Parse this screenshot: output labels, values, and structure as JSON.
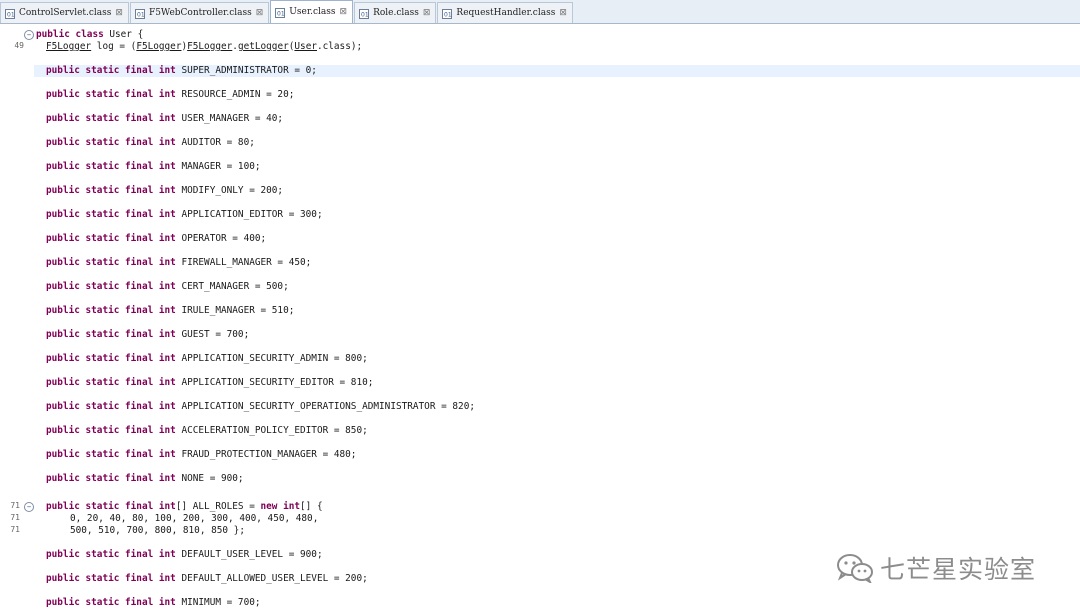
{
  "tabs": [
    {
      "label": "ControlServlet.class",
      "active": false
    },
    {
      "label": "F5WebController.class",
      "active": false
    },
    {
      "label": "User.class",
      "active": true
    },
    {
      "label": "Role.class",
      "active": false
    },
    {
      "label": "RequestHandler.class",
      "active": false
    }
  ],
  "gutter": {
    "line_49": "49",
    "line_71a": "71",
    "line_71b": "71",
    "line_71c": "71"
  },
  "code": {
    "class_decl_kw": "public class",
    "class_decl_rest": " User {",
    "log_type": "F5Logger",
    "log_mid": " log = (",
    "log_cast": "F5Logger",
    "log_close": ")",
    "log_call_type": "F5Logger",
    "log_dot": ".",
    "log_method": "getLogger",
    "log_open": "(",
    "log_arg": "User",
    "log_end": ".class);",
    "field_kw": "public static final int",
    "fields": [
      "SUPER_ADMINISTRATOR = 0;",
      "RESOURCE_ADMIN = 20;",
      "USER_MANAGER = 40;",
      "AUDITOR = 80;",
      "MANAGER = 100;",
      "MODIFY_ONLY = 200;",
      "APPLICATION_EDITOR = 300;",
      "OPERATOR = 400;",
      "FIREWALL_MANAGER = 450;",
      "CERT_MANAGER = 500;",
      "IRULE_MANAGER = 510;",
      "GUEST = 700;",
      "APPLICATION_SECURITY_ADMIN = 800;",
      "APPLICATION_SECURITY_EDITOR = 810;",
      "APPLICATION_SECURITY_OPERATIONS_ADMINISTRATOR = 820;",
      "ACCELERATION_POLICY_EDITOR = 850;",
      "FRAUD_PROTECTION_MANAGER = 480;",
      "NONE = 900;"
    ],
    "roles_kw": "public static final int",
    "roles_rest": "[] ALL_ROLES = ",
    "roles_new": "new int",
    "roles_end": "[] {",
    "roles_values_1": "0, 20, 40, 80, 100, 200, 300, 400, 450, 480,",
    "roles_values_2": "500, 510, 700, 800, 810, 850 };",
    "trailing_fields": [
      "DEFAULT_USER_LEVEL = 900;",
      "DEFAULT_ALLOWED_USER_LEVEL = 200;",
      "MINIMUM = 700;"
    ]
  },
  "watermark": {
    "text": "七芒星实验室",
    "icon": "wechat-icon"
  },
  "colors": {
    "keyword": "#7f0055",
    "highlight_line": "#e8f2fe"
  }
}
